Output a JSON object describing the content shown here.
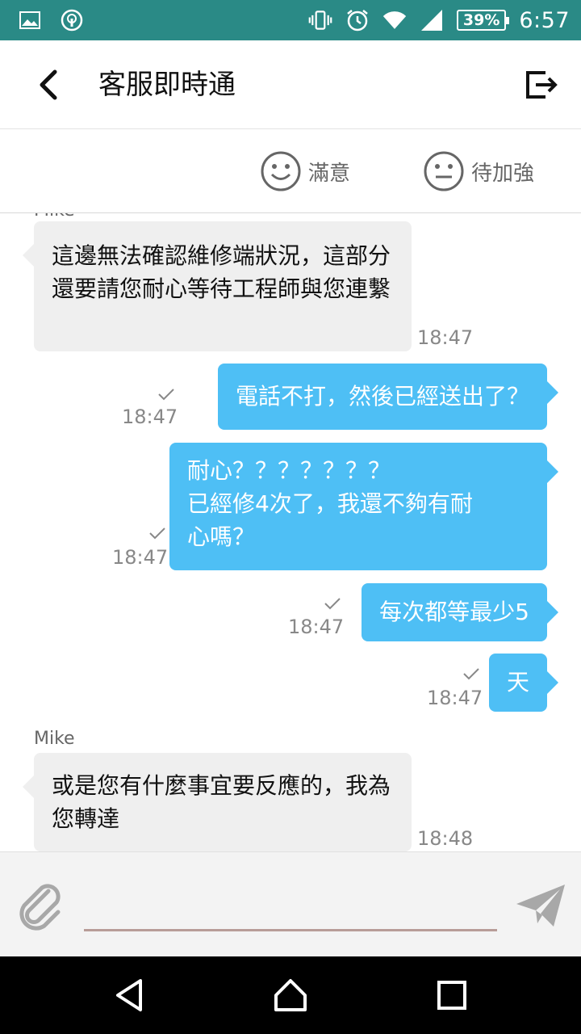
{
  "status_bar": {
    "battery": "39%",
    "time": "6:57",
    "icons": [
      "image-icon",
      "cast-icon",
      "vibrate-icon",
      "alarm-icon",
      "wifi-icon",
      "signal-icon",
      "battery-icon"
    ]
  },
  "app_bar": {
    "title": "客服即時通",
    "back_icon": "chevron-left-icon",
    "exit_icon": "exit-icon"
  },
  "rating": {
    "good_label": "滿意",
    "bad_label": "待加強"
  },
  "chat": {
    "top_sender": "Mike",
    "messages": [
      {
        "from": "agent",
        "text": "這邊無法確認維修端狀況，這部分還要請您耐心等待工程師與您連繫",
        "time": "18:47"
      },
      {
        "from": "user",
        "text": "電話不打，然後已經送出了？",
        "time": "18:47"
      },
      {
        "from": "user",
        "text": "耐心？？？？？？？\n已經修4次了，我還不夠有耐\n心嗎？",
        "time": "18:47"
      },
      {
        "from": "user",
        "text": "每次都等最少5",
        "time": "18:47"
      },
      {
        "from": "user",
        "text": "天",
        "time": "18:47"
      },
      {
        "from": "agent",
        "sender": "Mike",
        "text": "或是您有什麼事宜要反應的，我為您轉達",
        "time": "18:48"
      }
    ]
  },
  "input": {
    "value": "",
    "placeholder": ""
  },
  "colors": {
    "status_bar": "#2a8a86",
    "user_bubble": "#4ebff5",
    "agent_bubble": "#efefef",
    "input_underline": "#b89c98"
  }
}
